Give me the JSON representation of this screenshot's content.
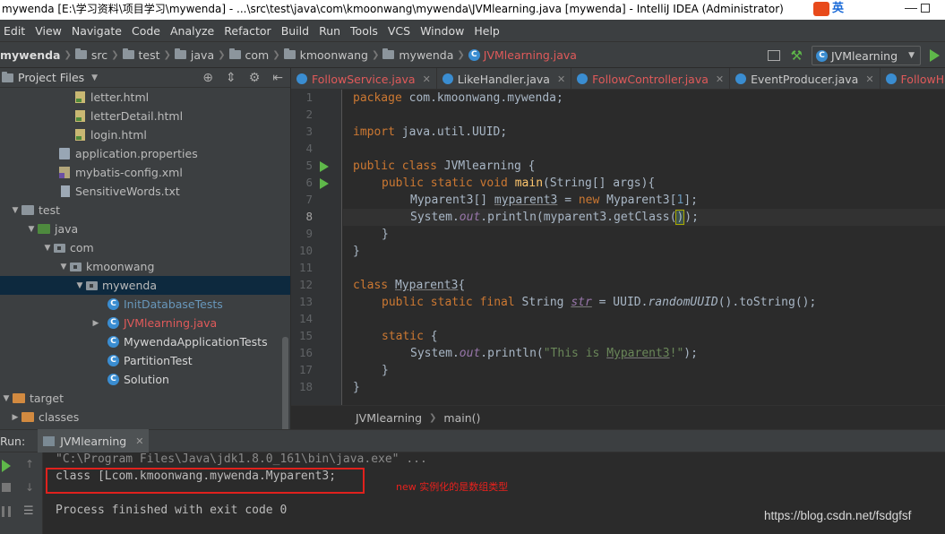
{
  "window": {
    "title": "mywenda [E:\\学习资料\\项目学习\\mywenda] - ...\\src\\test\\java\\com\\kmoonwang\\mywenda\\JVMlearning.java [mywenda] - IntelliJ IDEA (Administrator)",
    "ime_label": "英"
  },
  "menu": [
    "Edit",
    "View",
    "Navigate",
    "Code",
    "Analyze",
    "Refactor",
    "Build",
    "Run",
    "Tools",
    "VCS",
    "Window",
    "Help"
  ],
  "breadcrumb": {
    "items": [
      "mywenda",
      "src",
      "test",
      "java",
      "com",
      "kmoonwang",
      "mywenda",
      "JVMlearning.java"
    ]
  },
  "run_config": {
    "selected": "JVMlearning"
  },
  "project_panel": {
    "title": "Project Files",
    "tree": [
      {
        "label": "letter.html",
        "icon": "html-file-icon"
      },
      {
        "label": "letterDetail.html",
        "icon": "html-file-icon"
      },
      {
        "label": "login.html",
        "icon": "html-file-icon"
      },
      {
        "label": "application.properties",
        "icon": "properties-file-icon"
      },
      {
        "label": "mybatis-config.xml",
        "icon": "xml-file-icon"
      },
      {
        "label": "SensitiveWords.txt",
        "icon": "text-file-icon"
      },
      {
        "label": "test",
        "icon": "folder-icon"
      },
      {
        "label": "java",
        "icon": "source-folder-icon"
      },
      {
        "label": "com",
        "icon": "package-icon"
      },
      {
        "label": "kmoonwang",
        "icon": "package-icon"
      },
      {
        "label": "mywenda",
        "icon": "package-icon"
      },
      {
        "label": "InitDatabaseTests",
        "icon": "class-icon"
      },
      {
        "label": "JVMlearning.java",
        "icon": "class-icon"
      },
      {
        "label": "MywendaApplicationTests",
        "icon": "class-icon"
      },
      {
        "label": "PartitionTest",
        "icon": "class-icon"
      },
      {
        "label": "Solution",
        "icon": "class-icon"
      },
      {
        "label": "target",
        "icon": "folder-icon"
      },
      {
        "label": "classes",
        "icon": "folder-icon"
      }
    ]
  },
  "tabs": [
    "FollowService.java",
    "LikeHandler.java",
    "FollowController.java",
    "EventProducer.java",
    "FollowHa"
  ],
  "editor": {
    "line_numbers": [
      "1",
      "2",
      "3",
      "4",
      "5",
      "6",
      "7",
      "8",
      "9",
      "10",
      "11",
      "12",
      "13",
      "14",
      "15",
      "16",
      "17",
      "18"
    ],
    "code": {
      "l1_kw": "package",
      "l1_rest": " com.kmoonwang.mywenda;",
      "l3_kw": "import",
      "l3_rest": " java.util.UUID;",
      "l5_kw": "public class",
      "l5_rest": " JVMlearning {",
      "l6_kw": "public static void",
      "l6_mth": "main",
      "l6_rest": "(String[] args){",
      "l7_a": "Myparent3[] ",
      "l7_var": "myparent3",
      "l7_b": " = ",
      "l7_kw": "new",
      "l7_c": " Myparent3[",
      "l7_num": "1",
      "l7_d": "];",
      "l8_a": "System.",
      "l8_fld": "out",
      "l8_b": ".println(myparent3.getClass(",
      "l8_c": ")",
      "l8_d": ");",
      "l9": "}",
      "l10": "}",
      "l12_kw": "class",
      "l12_cls": "Myparent3",
      "l12_rest": "{",
      "l13_kw": "public static final",
      "l13_a": " String ",
      "l13_fld": "str",
      "l13_b": " = UUID.",
      "l13_it": "randomUUID",
      "l13_c": "().toString();",
      "l15_kw": "static",
      "l15_rest": " {",
      "l16_a": "System.",
      "l16_fld": "out",
      "l16_b": ".println(",
      "l16_str1": "\"This is ",
      "l16_str2": "Myparent3",
      "l16_str3": "!\"",
      "l16_c": ");",
      "l17": "}",
      "l18": "}"
    }
  },
  "editor_breadcrumb": [
    "JVMlearning",
    "main()"
  ],
  "run_panel": {
    "label": "Run:",
    "tab": "JVMlearning",
    "console": [
      "\"C:\\Program Files\\Java\\jdk1.8.0_161\\bin\\java.exe\" ...",
      "class [Lcom.kmoonwang.mywenda.Myparent3;",
      "Process finished with exit code 0"
    ]
  },
  "annotation": "new 实例化的是数组类型",
  "watermark": "https://blog.csdn.net/fsdgfsf"
}
